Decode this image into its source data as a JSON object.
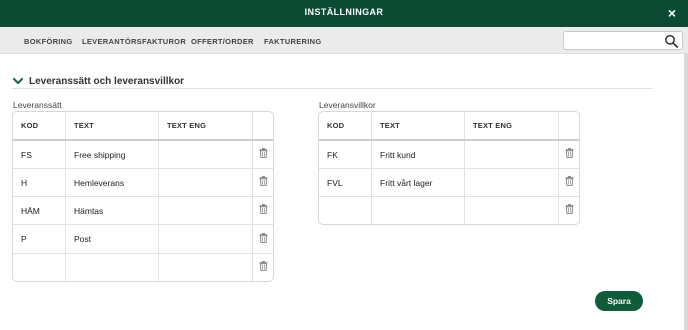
{
  "window": {
    "title": "INSTÄLLNINGAR",
    "close_glyph": "×"
  },
  "tabs": [
    {
      "label": "BOKFÖRING"
    },
    {
      "label": "LEVERANTÖRSFAKTUROR"
    },
    {
      "label": "OFFERT/ORDER"
    },
    {
      "label": "FAKTURERING"
    }
  ],
  "search": {
    "value": "",
    "placeholder": "",
    "icon": "search-icon"
  },
  "section": {
    "title": "Leveranssätt och leveransvillkor",
    "icon": "chevron-down-icon"
  },
  "leveranssatt": {
    "label": "Leveranssätt",
    "columns": [
      "KOD",
      "TEXT",
      "TEXT ENG"
    ],
    "rows": [
      {
        "kod": "FS",
        "text": "Free shipping",
        "text_eng": ""
      },
      {
        "kod": "H",
        "text": "Hemleverans",
        "text_eng": ""
      },
      {
        "kod": "HÄM",
        "text": "Hämtas",
        "text_eng": ""
      },
      {
        "kod": "P",
        "text": "Post",
        "text_eng": ""
      },
      {
        "kod": "",
        "text": "",
        "text_eng": ""
      }
    ]
  },
  "leveransvillkor": {
    "label": "Leveransvillkor",
    "columns": [
      "KOD",
      "TEXT",
      "TEXT ENG"
    ],
    "rows": [
      {
        "kod": "FK",
        "text": "Fritt kund",
        "text_eng": ""
      },
      {
        "kod": "FVL",
        "text": "Fritt vårt lager",
        "text_eng": ""
      },
      {
        "kod": "",
        "text": "",
        "text_eng": ""
      }
    ]
  },
  "actions": {
    "save_label": "Spara"
  },
  "colors": {
    "titlebar": "#0b4a33",
    "primary_button": "#0e5c3a",
    "tabbar": "#ebebeb"
  }
}
